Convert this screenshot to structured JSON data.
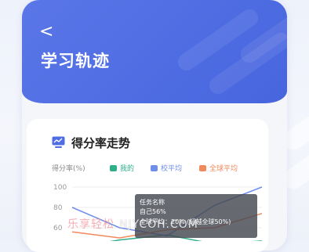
{
  "header": {
    "back_glyph": "<",
    "title": "学习轨迹"
  },
  "card": {
    "icon": "monitor-chart-icon",
    "title": "得分率走势"
  },
  "chart_data": {
    "type": "line",
    "ylabel": "得分率(%)",
    "y_ticks": [
      "100",
      "80",
      "60"
    ],
    "ylim": [
      40,
      100
    ],
    "x": [
      0,
      1,
      2,
      3,
      4
    ],
    "series": [
      {
        "name": "我的",
        "color": "#2db08a",
        "values": [
          40,
          48,
          53,
          44,
          47
        ]
      },
      {
        "name": "校平均",
        "color": "#6f8eea",
        "values": [
          80,
          60,
          52,
          82,
          100
        ]
      },
      {
        "name": "全球平均",
        "color": "#f08a5d",
        "values": [
          56,
          50,
          58,
          60,
          74
        ]
      }
    ],
    "tooltip": {
      "title": "任务名称",
      "line1": "自己56%",
      "line2": "全球平均：20% (超越全球50%)"
    }
  },
  "watermark": {
    "cn": "乐享轻松",
    "en": "NJYCOH.COM"
  },
  "colors": {
    "header": "#4f6de2",
    "card_bg": "#ffffff",
    "page_bg": "#f0f3fb"
  }
}
